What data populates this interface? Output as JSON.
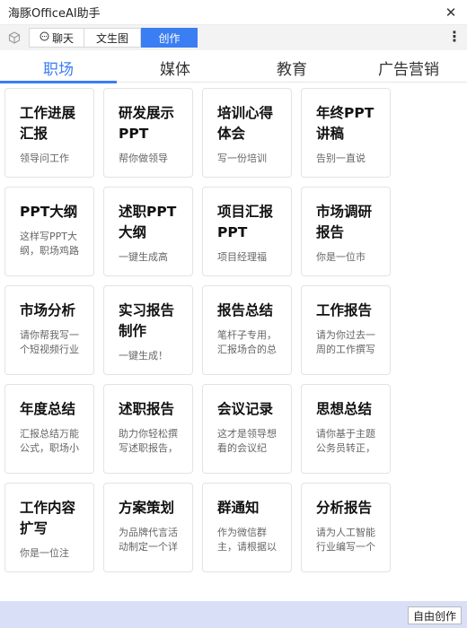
{
  "window": {
    "title": "海豚OfficeAI助手"
  },
  "toolbar": {
    "chat_label": "聊天",
    "doc_label": "文生图",
    "create_label": "创作"
  },
  "categories": [
    "职场",
    "媒体",
    "教育",
    "广告营销"
  ],
  "cards": [
    {
      "title": "工作进展汇报",
      "desc": "领导问工作"
    },
    {
      "title": "研发展示PPT",
      "desc": "帮你做领导"
    },
    {
      "title": "培训心得体会",
      "desc": "写一份培训"
    },
    {
      "title": "年终PPT讲稿",
      "desc": "告别一直说"
    },
    {
      "title": "PPT大纲",
      "desc": "这样写PPT大纲，职场鸡路少走一半"
    },
    {
      "title": "述职PPT大纲",
      "desc": "一键生成高"
    },
    {
      "title": "项目汇报PPT",
      "desc": "项目经理福"
    },
    {
      "title": "市场调研报告",
      "desc": "你是一位市"
    },
    {
      "title": "市场分析",
      "desc": "请你帮我写一个短视频行业的市场"
    },
    {
      "title": "实习报告制作",
      "desc": "一键生成！"
    },
    {
      "title": "报告总结",
      "desc": "笔杆子专用，汇报场合的总结发"
    },
    {
      "title": "工作报告",
      "desc": "请为你过去一周的工作撰写一份工"
    },
    {
      "title": "年度总结",
      "desc": "汇报总结万能公式，职场小白秒变"
    },
    {
      "title": "述职报告",
      "desc": "助力你轻松撰写述职报告，明晰展"
    },
    {
      "title": "会议记录",
      "desc": "这才是领导想看的会议纪要，三分"
    },
    {
      "title": "思想总结",
      "desc": "请你基于主题公务员转正，生成一"
    },
    {
      "title": "工作内容扩写",
      "desc": "你是一位注"
    },
    {
      "title": "方案策划",
      "desc": "为品牌代言活动制定一个详细创新"
    },
    {
      "title": "群通知",
      "desc": "作为微信群主，请根据以下要求"
    },
    {
      "title": "分析报告",
      "desc": "请为人工智能行业编写一个结构清"
    }
  ],
  "footer": {
    "free_create_label": "自由创作"
  }
}
